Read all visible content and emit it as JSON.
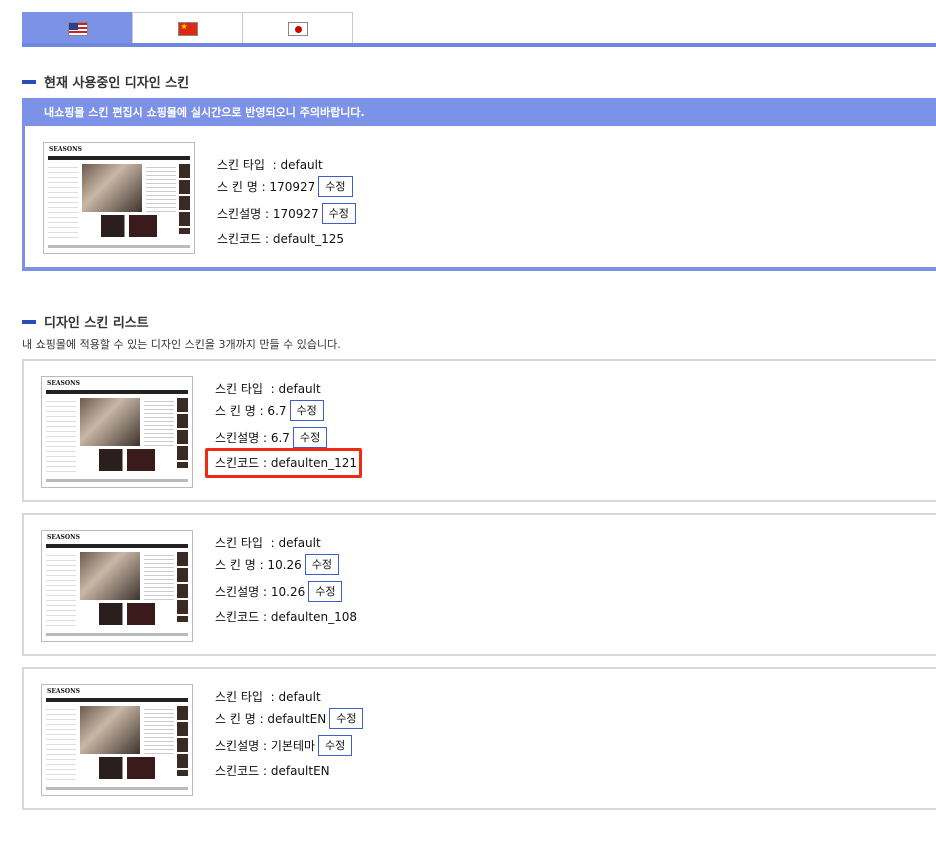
{
  "tabs": [
    {
      "name": "us-flag-icon",
      "active": true
    },
    {
      "name": "china-flag-icon",
      "active": false
    },
    {
      "name": "japan-flag-icon",
      "active": false
    }
  ],
  "current": {
    "title": "현재 사용중인 디자인 스킨",
    "notice": "내쇼핑몰 스킨 편집시 쇼핑몰에 실시간으로 반영되오니 주의바랍니다.",
    "type_label": "스킨 타입",
    "type_value": ": default",
    "name_label": "스 킨 명",
    "name_value": ": 170927",
    "desc_label": "스킨설명",
    "desc_value": ": 170927",
    "code_label": "스킨코드",
    "code_value": ": default_125",
    "edit_label": "수정",
    "thumb_logo": "SEASONS"
  },
  "list": {
    "title": "디자인 스킨 리스트",
    "description": "내 쇼핑몰에 적용할 수 있는 디자인 스킨을 3개까지 만들 수 있습니다.",
    "edit_label": "수정",
    "items": [
      {
        "type_label": "스킨 타입",
        "type_value": ": default",
        "name_label": "스 킨 명",
        "name_value": ": 6.7",
        "desc_label": "스킨설명",
        "desc_value": ": 6.7",
        "code_label": "스킨코드",
        "code_value": ": defaulten_121",
        "thumb_logo": "SEASONS"
      },
      {
        "type_label": "스킨 타입",
        "type_value": ": default",
        "name_label": "스 킨 명",
        "name_value": ": 10.26",
        "desc_label": "스킨설명",
        "desc_value": ": 10.26",
        "code_label": "스킨코드",
        "code_value": ": defaulten_108",
        "thumb_logo": "SEASONS"
      },
      {
        "type_label": "스킨 타입",
        "type_value": ": default",
        "name_label": "스 킨 명",
        "name_value": ": defaultEN",
        "desc_label": "스킨설명",
        "desc_value": ": 기본테마",
        "code_label": "스킨코드",
        "code_value": ": defaultEN",
        "thumb_logo": "SEASONS"
      }
    ]
  },
  "colors": {
    "accent": "#7b92e6",
    "heading_bar": "#2b4bb8",
    "highlight": "#ee2a10"
  }
}
